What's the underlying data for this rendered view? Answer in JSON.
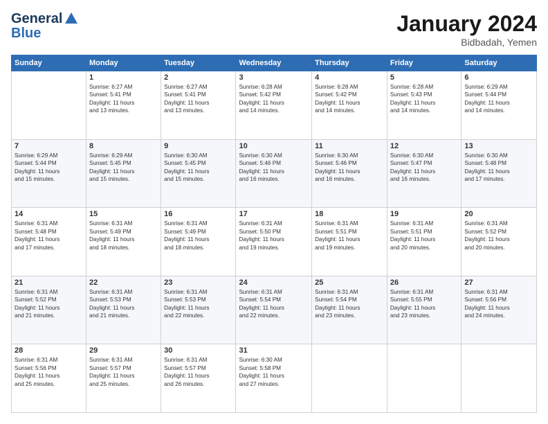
{
  "header": {
    "logo_line1": "General",
    "logo_line2": "Blue",
    "month_year": "January 2024",
    "location": "Bidbadah, Yemen"
  },
  "weekdays": [
    "Sunday",
    "Monday",
    "Tuesday",
    "Wednesday",
    "Thursday",
    "Friday",
    "Saturday"
  ],
  "weeks": [
    [
      {
        "day": "",
        "info": ""
      },
      {
        "day": "1",
        "info": "Sunrise: 6:27 AM\nSunset: 5:41 PM\nDaylight: 11 hours\nand 13 minutes."
      },
      {
        "day": "2",
        "info": "Sunrise: 6:27 AM\nSunset: 5:41 PM\nDaylight: 11 hours\nand 13 minutes."
      },
      {
        "day": "3",
        "info": "Sunrise: 6:28 AM\nSunset: 5:42 PM\nDaylight: 11 hours\nand 14 minutes."
      },
      {
        "day": "4",
        "info": "Sunrise: 6:28 AM\nSunset: 5:42 PM\nDaylight: 11 hours\nand 14 minutes."
      },
      {
        "day": "5",
        "info": "Sunrise: 6:28 AM\nSunset: 5:43 PM\nDaylight: 11 hours\nand 14 minutes."
      },
      {
        "day": "6",
        "info": "Sunrise: 6:29 AM\nSunset: 5:44 PM\nDaylight: 11 hours\nand 14 minutes."
      }
    ],
    [
      {
        "day": "7",
        "info": "Sunrise: 6:29 AM\nSunset: 5:44 PM\nDaylight: 11 hours\nand 15 minutes."
      },
      {
        "day": "8",
        "info": "Sunrise: 6:29 AM\nSunset: 5:45 PM\nDaylight: 11 hours\nand 15 minutes."
      },
      {
        "day": "9",
        "info": "Sunrise: 6:30 AM\nSunset: 5:45 PM\nDaylight: 11 hours\nand 15 minutes."
      },
      {
        "day": "10",
        "info": "Sunrise: 6:30 AM\nSunset: 5:46 PM\nDaylight: 11 hours\nand 16 minutes."
      },
      {
        "day": "11",
        "info": "Sunrise: 6:30 AM\nSunset: 5:46 PM\nDaylight: 11 hours\nand 16 minutes."
      },
      {
        "day": "12",
        "info": "Sunrise: 6:30 AM\nSunset: 5:47 PM\nDaylight: 11 hours\nand 16 minutes."
      },
      {
        "day": "13",
        "info": "Sunrise: 6:30 AM\nSunset: 5:48 PM\nDaylight: 11 hours\nand 17 minutes."
      }
    ],
    [
      {
        "day": "14",
        "info": "Sunrise: 6:31 AM\nSunset: 5:48 PM\nDaylight: 11 hours\nand 17 minutes."
      },
      {
        "day": "15",
        "info": "Sunrise: 6:31 AM\nSunset: 5:49 PM\nDaylight: 11 hours\nand 18 minutes."
      },
      {
        "day": "16",
        "info": "Sunrise: 6:31 AM\nSunset: 5:49 PM\nDaylight: 11 hours\nand 18 minutes."
      },
      {
        "day": "17",
        "info": "Sunrise: 6:31 AM\nSunset: 5:50 PM\nDaylight: 11 hours\nand 19 minutes."
      },
      {
        "day": "18",
        "info": "Sunrise: 6:31 AM\nSunset: 5:51 PM\nDaylight: 11 hours\nand 19 minutes."
      },
      {
        "day": "19",
        "info": "Sunrise: 6:31 AM\nSunset: 5:51 PM\nDaylight: 11 hours\nand 20 minutes."
      },
      {
        "day": "20",
        "info": "Sunrise: 6:31 AM\nSunset: 5:52 PM\nDaylight: 11 hours\nand 20 minutes."
      }
    ],
    [
      {
        "day": "21",
        "info": "Sunrise: 6:31 AM\nSunset: 5:52 PM\nDaylight: 11 hours\nand 21 minutes."
      },
      {
        "day": "22",
        "info": "Sunrise: 6:31 AM\nSunset: 5:53 PM\nDaylight: 11 hours\nand 21 minutes."
      },
      {
        "day": "23",
        "info": "Sunrise: 6:31 AM\nSunset: 5:53 PM\nDaylight: 11 hours\nand 22 minutes."
      },
      {
        "day": "24",
        "info": "Sunrise: 6:31 AM\nSunset: 5:54 PM\nDaylight: 11 hours\nand 22 minutes."
      },
      {
        "day": "25",
        "info": "Sunrise: 6:31 AM\nSunset: 5:54 PM\nDaylight: 11 hours\nand 23 minutes."
      },
      {
        "day": "26",
        "info": "Sunrise: 6:31 AM\nSunset: 5:55 PM\nDaylight: 11 hours\nand 23 minutes."
      },
      {
        "day": "27",
        "info": "Sunrise: 6:31 AM\nSunset: 5:56 PM\nDaylight: 11 hours\nand 24 minutes."
      }
    ],
    [
      {
        "day": "28",
        "info": "Sunrise: 6:31 AM\nSunset: 5:56 PM\nDaylight: 11 hours\nand 25 minutes."
      },
      {
        "day": "29",
        "info": "Sunrise: 6:31 AM\nSunset: 5:57 PM\nDaylight: 11 hours\nand 25 minutes."
      },
      {
        "day": "30",
        "info": "Sunrise: 6:31 AM\nSunset: 5:57 PM\nDaylight: 11 hours\nand 26 minutes."
      },
      {
        "day": "31",
        "info": "Sunrise: 6:30 AM\nSunset: 5:58 PM\nDaylight: 11 hours\nand 27 minutes."
      },
      {
        "day": "",
        "info": ""
      },
      {
        "day": "",
        "info": ""
      },
      {
        "day": "",
        "info": ""
      }
    ]
  ]
}
